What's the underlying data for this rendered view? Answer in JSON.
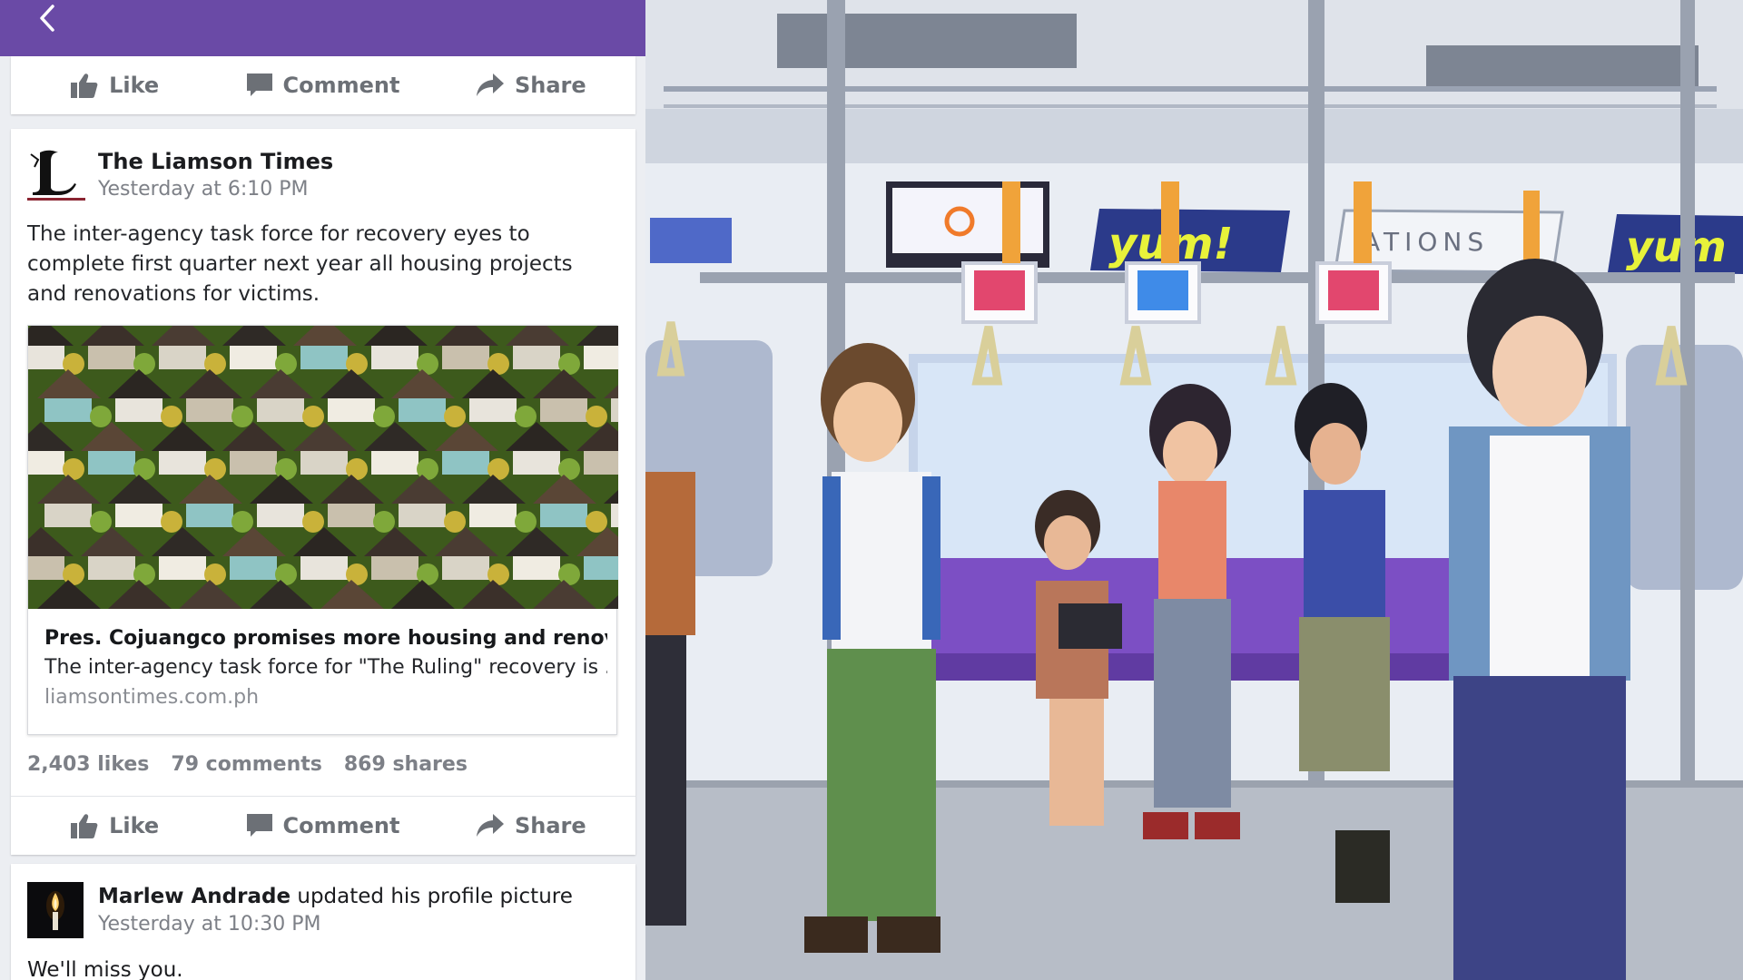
{
  "feed": {
    "top_actions": {
      "like": "Like",
      "comment": "Comment",
      "share": "Share"
    },
    "post": {
      "source": "The Liamson Times",
      "time": "Yesterday at 6:10 PM",
      "text": "The inter-agency task force for recovery eyes to complete first quarter next year all housing projects and renovations for victims.",
      "link": {
        "title": "Pres. Cojuangco promises more housing and renovation ...",
        "description": "The inter-agency task force for \"The Ruling\" recovery is ...",
        "domain": "liamsontimes.com.ph"
      },
      "stats": {
        "likes": "2,403 likes",
        "comments": "79 comments",
        "shares": "869 shares"
      },
      "actions": {
        "like": "Like",
        "comment": "Comment",
        "share": "Share"
      }
    },
    "next_post": {
      "author": "Marlew Andrade",
      "action": " updated his profile picture",
      "time": "Yesterday at 10:30 PM",
      "text": "We'll miss you."
    }
  },
  "scene": {
    "ad_signs": [
      "yum!",
      "ATIONS",
      "yum"
    ]
  },
  "colors": {
    "topbar": "#6a4aa6",
    "action_gray": "#6c7076",
    "train_seat": "#7c4fc4"
  }
}
